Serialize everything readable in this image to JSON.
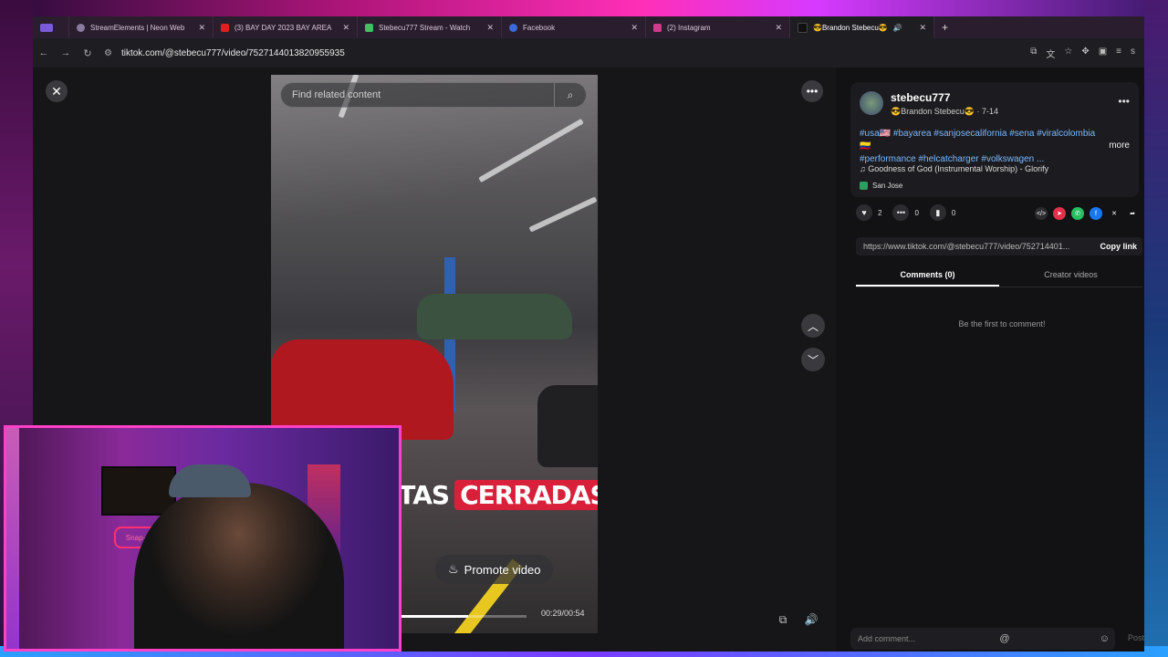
{
  "tabs": [
    {
      "title": "StreamElements | Neon Web",
      "fav_color": "#8a7aa0"
    },
    {
      "title": "(3) BAY DAY 2023 BAY AREA",
      "fav_color": "#e02020"
    },
    {
      "title": "Stebecu777 Stream - Watch",
      "fav_color": "#40c060"
    },
    {
      "title": "Facebook",
      "fav_color": "#3a6ad8"
    },
    {
      "title": "(2) Instagram",
      "fav_color": "#d03a8a"
    },
    {
      "title": "😎Brandon Stebecu😎",
      "fav_color": "#111111"
    }
  ],
  "browser": {
    "url": "tiktok.com/@stebecu777/video/7527144013820955935",
    "new_tab_icon": "+"
  },
  "video": {
    "search_placeholder": "Find related content",
    "caption_a": "RTAS",
    "caption_b": "CERRADAS",
    "pill_left": "cs",
    "promote_label": "Promote video",
    "time": "00:29/00:54",
    "progress": 0.54
  },
  "post": {
    "username": "stebecu777",
    "nickname": "😎Brandon Stebecu😎",
    "date": "7-14",
    "description_line1": "#usa🇺🇸 #bayarea #sanjosecalifornia #sena #viralcolombia🇨🇴",
    "description_line2": "#performance #helcatcharger #volkswagen ...",
    "more_label": "more",
    "music": "Goodness of God (Instrumental Worship) - Glorify",
    "location": "San Jose",
    "likes": "2",
    "comments": "0",
    "saves": "0",
    "link": "https://www.tiktok.com/@stebecu777/video/752714401...",
    "copy_label": "Copy link",
    "tab_comments": "Comments (0)",
    "tab_creator": "Creator videos",
    "empty_text": "Be the first to comment!",
    "comment_placeholder": "Add comment...",
    "post_label": "Post"
  },
  "cam": {
    "sign_text": "Snap-on"
  }
}
